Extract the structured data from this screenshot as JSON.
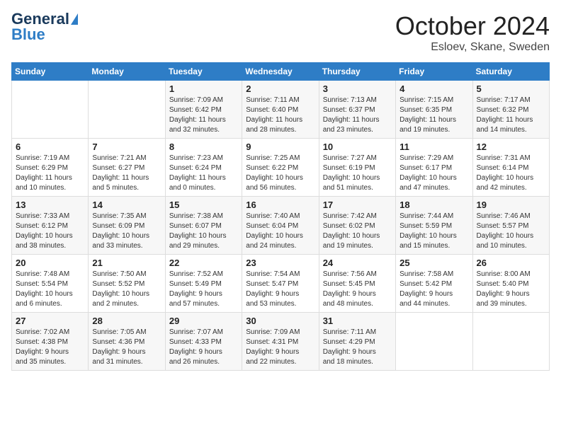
{
  "logo": {
    "part1": "General",
    "part2": "Blue"
  },
  "title": "October 2024",
  "location": "Esloev, Skane, Sweden",
  "headers": [
    "Sunday",
    "Monday",
    "Tuesday",
    "Wednesday",
    "Thursday",
    "Friday",
    "Saturday"
  ],
  "weeks": [
    [
      {
        "day": "",
        "info": ""
      },
      {
        "day": "",
        "info": ""
      },
      {
        "day": "1",
        "info": "Sunrise: 7:09 AM\nSunset: 6:42 PM\nDaylight: 11 hours\nand 32 minutes."
      },
      {
        "day": "2",
        "info": "Sunrise: 7:11 AM\nSunset: 6:40 PM\nDaylight: 11 hours\nand 28 minutes."
      },
      {
        "day": "3",
        "info": "Sunrise: 7:13 AM\nSunset: 6:37 PM\nDaylight: 11 hours\nand 23 minutes."
      },
      {
        "day": "4",
        "info": "Sunrise: 7:15 AM\nSunset: 6:35 PM\nDaylight: 11 hours\nand 19 minutes."
      },
      {
        "day": "5",
        "info": "Sunrise: 7:17 AM\nSunset: 6:32 PM\nDaylight: 11 hours\nand 14 minutes."
      }
    ],
    [
      {
        "day": "6",
        "info": "Sunrise: 7:19 AM\nSunset: 6:29 PM\nDaylight: 11 hours\nand 10 minutes."
      },
      {
        "day": "7",
        "info": "Sunrise: 7:21 AM\nSunset: 6:27 PM\nDaylight: 11 hours\nand 5 minutes."
      },
      {
        "day": "8",
        "info": "Sunrise: 7:23 AM\nSunset: 6:24 PM\nDaylight: 11 hours\nand 0 minutes."
      },
      {
        "day": "9",
        "info": "Sunrise: 7:25 AM\nSunset: 6:22 PM\nDaylight: 10 hours\nand 56 minutes."
      },
      {
        "day": "10",
        "info": "Sunrise: 7:27 AM\nSunset: 6:19 PM\nDaylight: 10 hours\nand 51 minutes."
      },
      {
        "day": "11",
        "info": "Sunrise: 7:29 AM\nSunset: 6:17 PM\nDaylight: 10 hours\nand 47 minutes."
      },
      {
        "day": "12",
        "info": "Sunrise: 7:31 AM\nSunset: 6:14 PM\nDaylight: 10 hours\nand 42 minutes."
      }
    ],
    [
      {
        "day": "13",
        "info": "Sunrise: 7:33 AM\nSunset: 6:12 PM\nDaylight: 10 hours\nand 38 minutes."
      },
      {
        "day": "14",
        "info": "Sunrise: 7:35 AM\nSunset: 6:09 PM\nDaylight: 10 hours\nand 33 minutes."
      },
      {
        "day": "15",
        "info": "Sunrise: 7:38 AM\nSunset: 6:07 PM\nDaylight: 10 hours\nand 29 minutes."
      },
      {
        "day": "16",
        "info": "Sunrise: 7:40 AM\nSunset: 6:04 PM\nDaylight: 10 hours\nand 24 minutes."
      },
      {
        "day": "17",
        "info": "Sunrise: 7:42 AM\nSunset: 6:02 PM\nDaylight: 10 hours\nand 19 minutes."
      },
      {
        "day": "18",
        "info": "Sunrise: 7:44 AM\nSunset: 5:59 PM\nDaylight: 10 hours\nand 15 minutes."
      },
      {
        "day": "19",
        "info": "Sunrise: 7:46 AM\nSunset: 5:57 PM\nDaylight: 10 hours\nand 10 minutes."
      }
    ],
    [
      {
        "day": "20",
        "info": "Sunrise: 7:48 AM\nSunset: 5:54 PM\nDaylight: 10 hours\nand 6 minutes."
      },
      {
        "day": "21",
        "info": "Sunrise: 7:50 AM\nSunset: 5:52 PM\nDaylight: 10 hours\nand 2 minutes."
      },
      {
        "day": "22",
        "info": "Sunrise: 7:52 AM\nSunset: 5:49 PM\nDaylight: 9 hours\nand 57 minutes."
      },
      {
        "day": "23",
        "info": "Sunrise: 7:54 AM\nSunset: 5:47 PM\nDaylight: 9 hours\nand 53 minutes."
      },
      {
        "day": "24",
        "info": "Sunrise: 7:56 AM\nSunset: 5:45 PM\nDaylight: 9 hours\nand 48 minutes."
      },
      {
        "day": "25",
        "info": "Sunrise: 7:58 AM\nSunset: 5:42 PM\nDaylight: 9 hours\nand 44 minutes."
      },
      {
        "day": "26",
        "info": "Sunrise: 8:00 AM\nSunset: 5:40 PM\nDaylight: 9 hours\nand 39 minutes."
      }
    ],
    [
      {
        "day": "27",
        "info": "Sunrise: 7:02 AM\nSunset: 4:38 PM\nDaylight: 9 hours\nand 35 minutes."
      },
      {
        "day": "28",
        "info": "Sunrise: 7:05 AM\nSunset: 4:36 PM\nDaylight: 9 hours\nand 31 minutes."
      },
      {
        "day": "29",
        "info": "Sunrise: 7:07 AM\nSunset: 4:33 PM\nDaylight: 9 hours\nand 26 minutes."
      },
      {
        "day": "30",
        "info": "Sunrise: 7:09 AM\nSunset: 4:31 PM\nDaylight: 9 hours\nand 22 minutes."
      },
      {
        "day": "31",
        "info": "Sunrise: 7:11 AM\nSunset: 4:29 PM\nDaylight: 9 hours\nand 18 minutes."
      },
      {
        "day": "",
        "info": ""
      },
      {
        "day": "",
        "info": ""
      }
    ]
  ]
}
